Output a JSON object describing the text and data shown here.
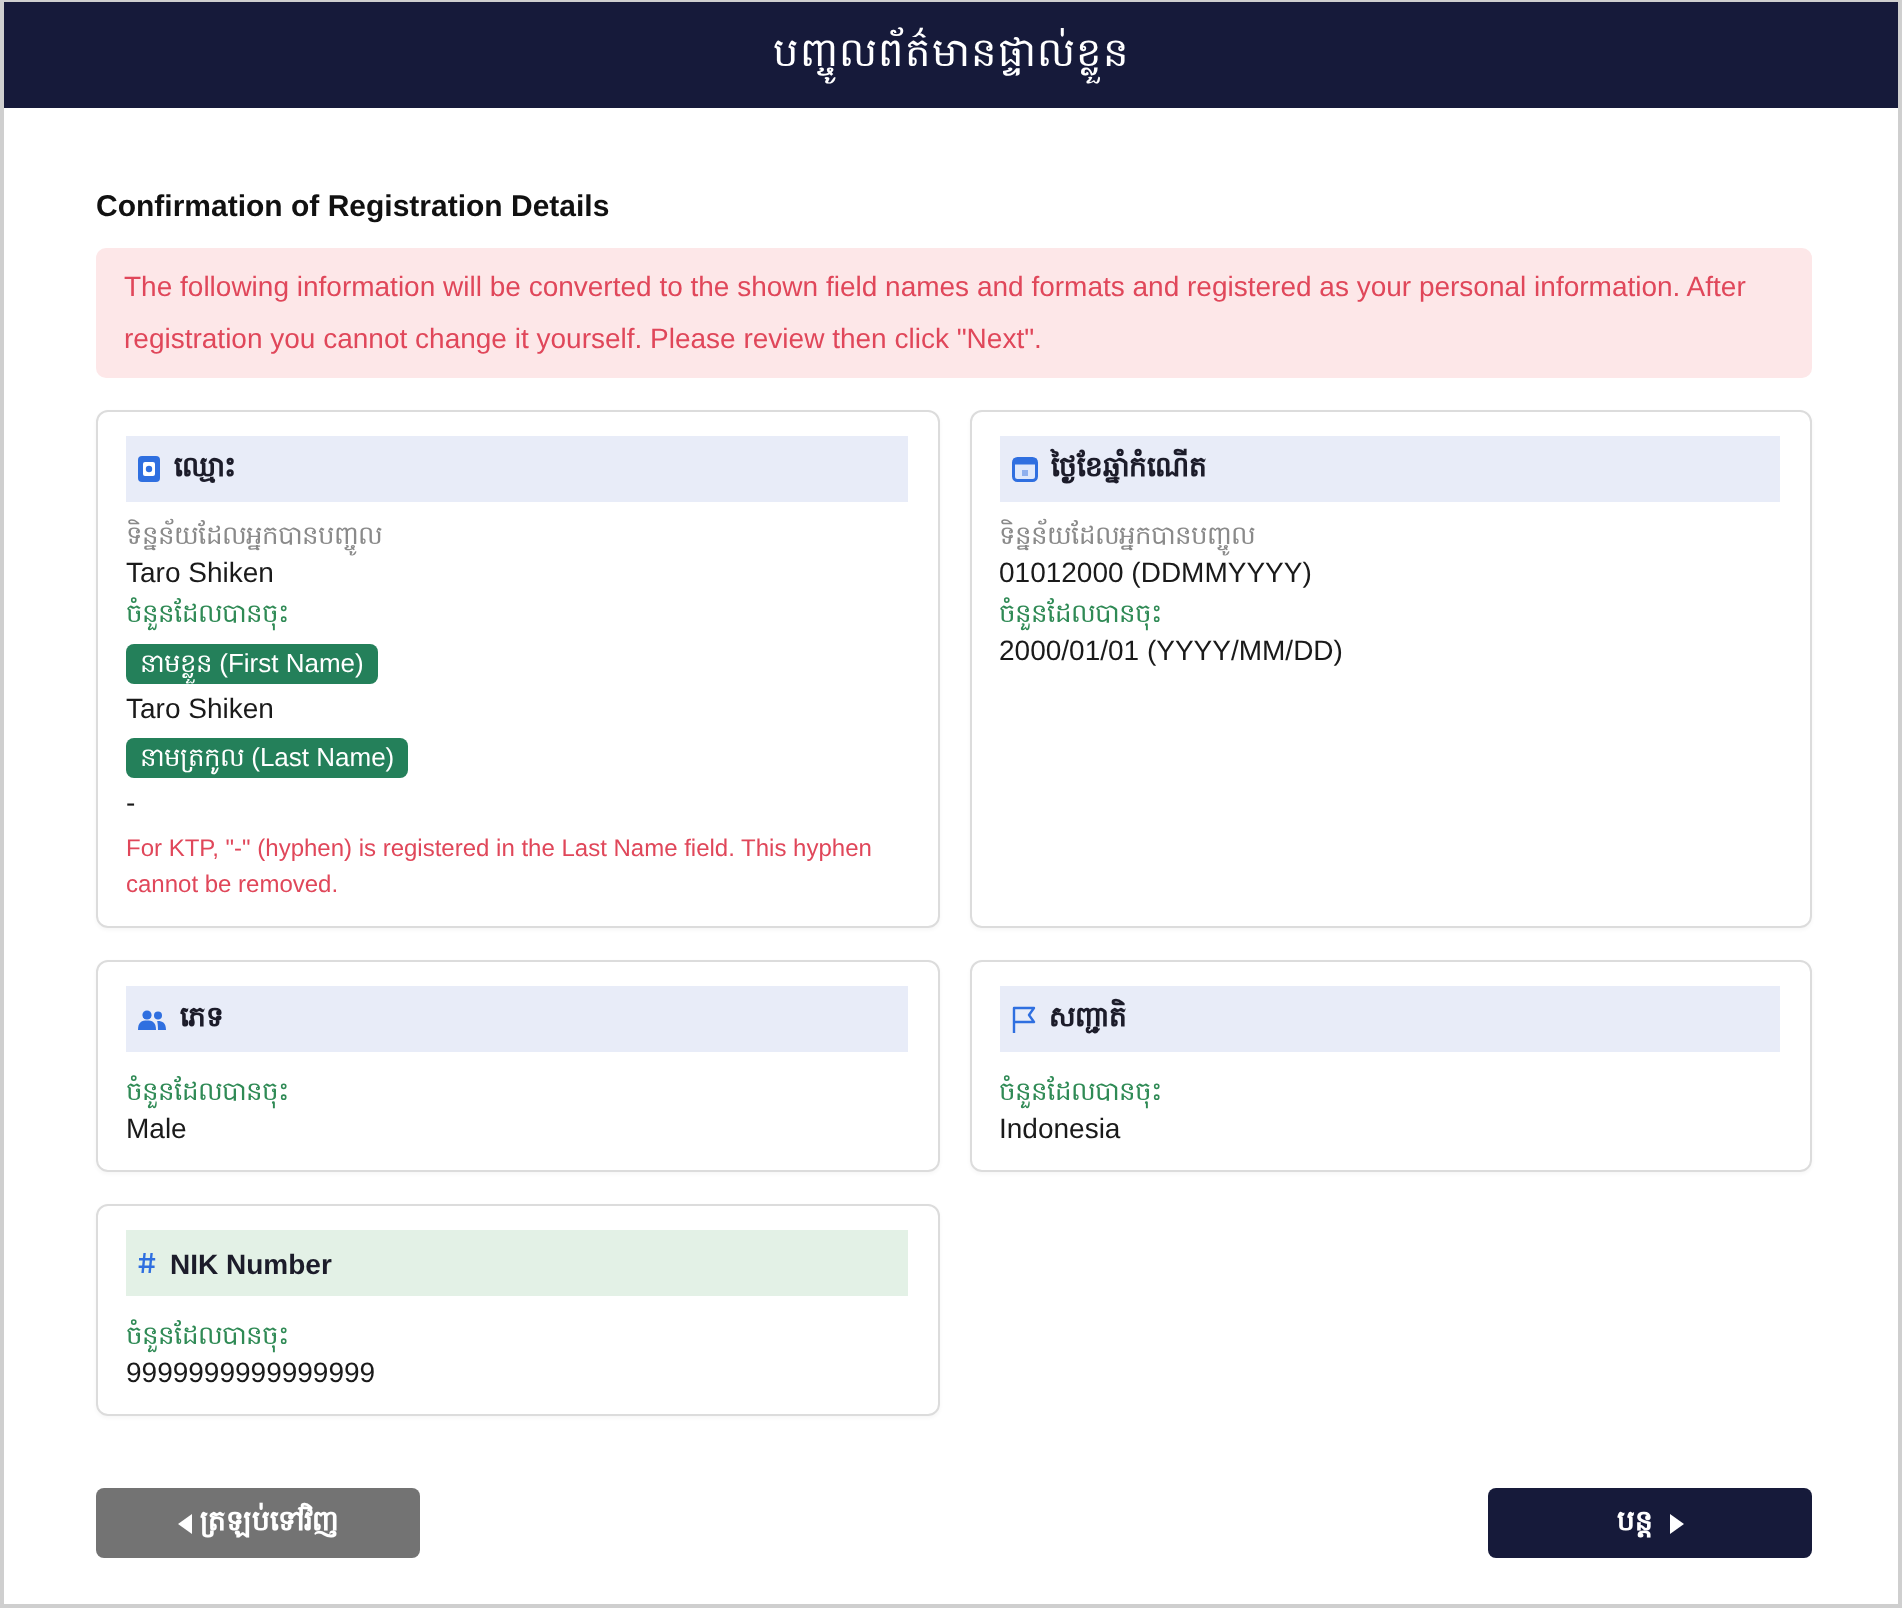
{
  "header": {
    "title": "បញ្ចូលព័ត៌មានផ្ទាល់ខ្លួន"
  },
  "confirmation": {
    "heading": "Confirmation of Registration Details",
    "notice": "The following information will be converted to the shown field names and formats and registered as your personal information. After registration you cannot change it yourself. Please review then click \"Next\"."
  },
  "cards": [
    {
      "kind": "name",
      "color": "#e8ecf8",
      "title": "ឈ្មោះ",
      "entered": {
        "label": "ទិន្នន័យដែលអ្នកបានបញ្ចូល",
        "value": "Taro Shiken"
      },
      "registered": {
        "label": "ចំនួនដែលបានចុះ",
        "items": [
          {
            "badge": "នាមខ្លួន (First Name)",
            "value": "Taro Shiken"
          },
          {
            "badge": "នាមត្រកូល (Last Name)",
            "value": "-"
          }
        ]
      },
      "note": "For KTP, \"-\" (hyphen) is registered in the Last Name field. This hyphen cannot be removed."
    },
    {
      "kind": "birth_date",
      "color": "#e8ecf8",
      "title": "ថ្ងៃខែឆ្នាំកំណើត",
      "entered": {
        "label": "ទិន្នន័យដែលអ្នកបានបញ្ចូល",
        "value": "01012000 (DDMMYYYY)"
      },
      "registered": {
        "label": "ចំនួនដែលបានចុះ",
        "items": [
          {
            "value": "2000/01/01 (YYYY/MM/DD)"
          }
        ]
      }
    },
    {
      "kind": "gender",
      "color": "#e8ecf8",
      "title": "ភេទ",
      "registered": {
        "label": "ចំនួនដែលបានចុះ",
        "items": [
          {
            "value": "Male"
          }
        ]
      }
    },
    {
      "kind": "nationality",
      "color": "#e8ecf8",
      "title": "សញ្ជាតិ",
      "registered": {
        "label": "ចំនួនដែលបានចុះ",
        "items": [
          {
            "value": "Indonesia"
          }
        ]
      }
    },
    {
      "kind": "number",
      "color": "#e3f1e6",
      "title": "NIK Number",
      "registered": {
        "label": "ចំនួនដែលបានចុះ",
        "items": [
          {
            "value": "9999999999999999"
          }
        ]
      }
    }
  ],
  "buttons": {
    "back": {
      "label": "ត្រឡប់ទៅវិញ"
    },
    "next": {
      "label": "បន្ត"
    }
  }
}
